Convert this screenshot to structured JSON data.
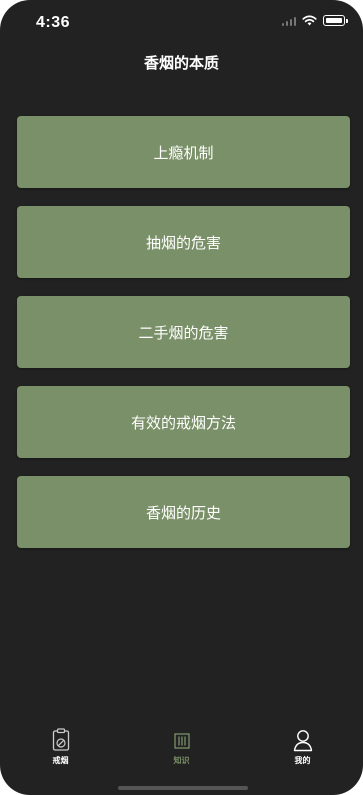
{
  "status_bar": {
    "time": "4:36"
  },
  "header": {
    "title": "香烟的本质"
  },
  "menu": {
    "items": [
      {
        "label": "上瘾机制"
      },
      {
        "label": "抽烟的危害"
      },
      {
        "label": "二手烟的危害"
      },
      {
        "label": "有效的戒烟方法"
      },
      {
        "label": "香烟的历史"
      }
    ]
  },
  "tabs": [
    {
      "label": "戒烟",
      "icon": "quit-smoking-icon",
      "active": false
    },
    {
      "label": "知识",
      "icon": "knowledge-icon",
      "active": true
    },
    {
      "label": "我的",
      "icon": "profile-icon",
      "active": false
    }
  ],
  "colors": {
    "background": "#222222",
    "card": "#7a9068",
    "active_tab": "#7a9068"
  }
}
